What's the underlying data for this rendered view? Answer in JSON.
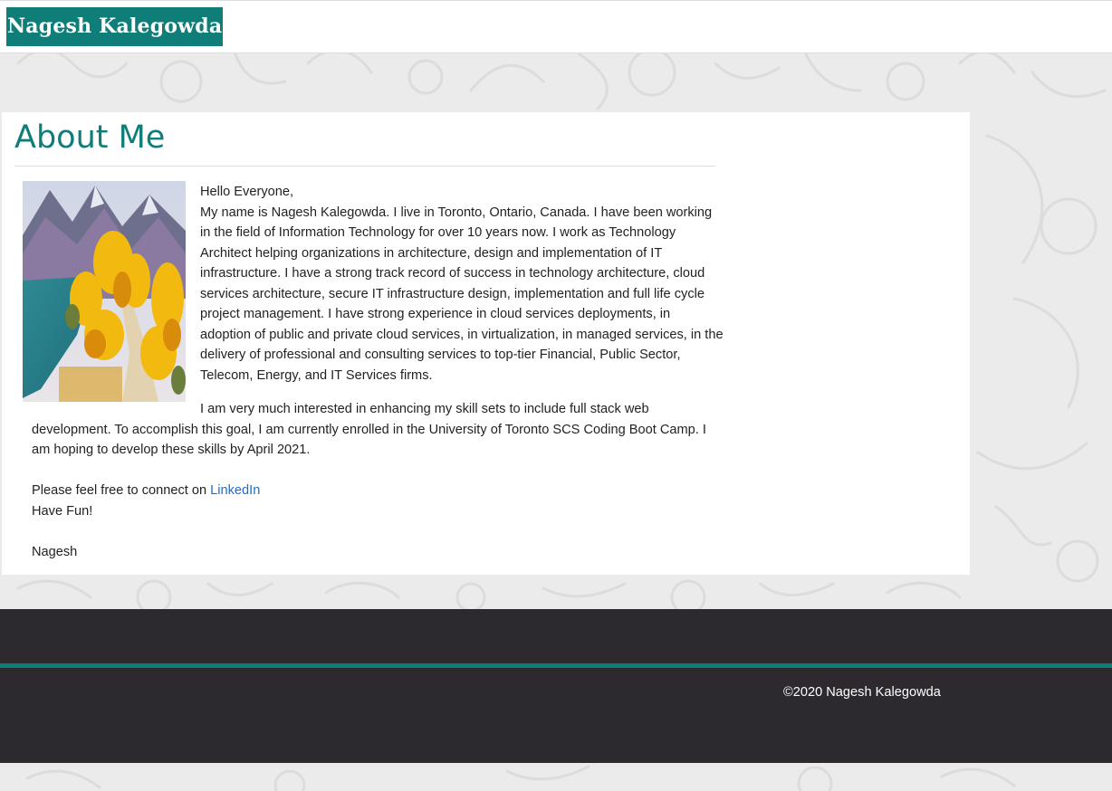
{
  "header": {
    "brand": "Nagesh Kalegowda"
  },
  "about": {
    "title": "About Me",
    "photo_icon": "landscape-painting",
    "greeting": "Hello Everyone,",
    "paragraph1": "My name is Nagesh Kalegowda. I live in Toronto, Ontario, Canada. I have been working in the field of Information Technology for over 10 years now. I work as Technology Architect helping organizations in architecture, design and implementation of IT infrastructure. I have a strong track record of success in technology architecture, cloud services architecture, secure IT infrastructure design, implementation and full life cycle project management. I have strong experience in cloud services deployments, in adoption of public and private cloud services, in virtualization, in managed services, in the delivery of professional and consulting services to top-tier Financial, Public Sector, Telecom, Energy, and IT Services firms.",
    "paragraph2": "I am very much interested in enhancing my skill sets to include full stack web development. To accomplish this goal, I am currently enrolled in the University of Toronto SCS Coding Boot Camp. I am hoping to develop these skills by April 2021.",
    "connect_text": "Please feel free to connect on ",
    "connect_link": "LinkedIn",
    "closing": "Have Fun!",
    "signature": "Nagesh"
  },
  "footer": {
    "copyright": "©2020 Nagesh Kalegowda"
  },
  "colors": {
    "brand": "#0f7d78",
    "footer_bg": "#2c2a2f",
    "link": "#1a6fd0",
    "page_bg": "#ebebeb"
  }
}
